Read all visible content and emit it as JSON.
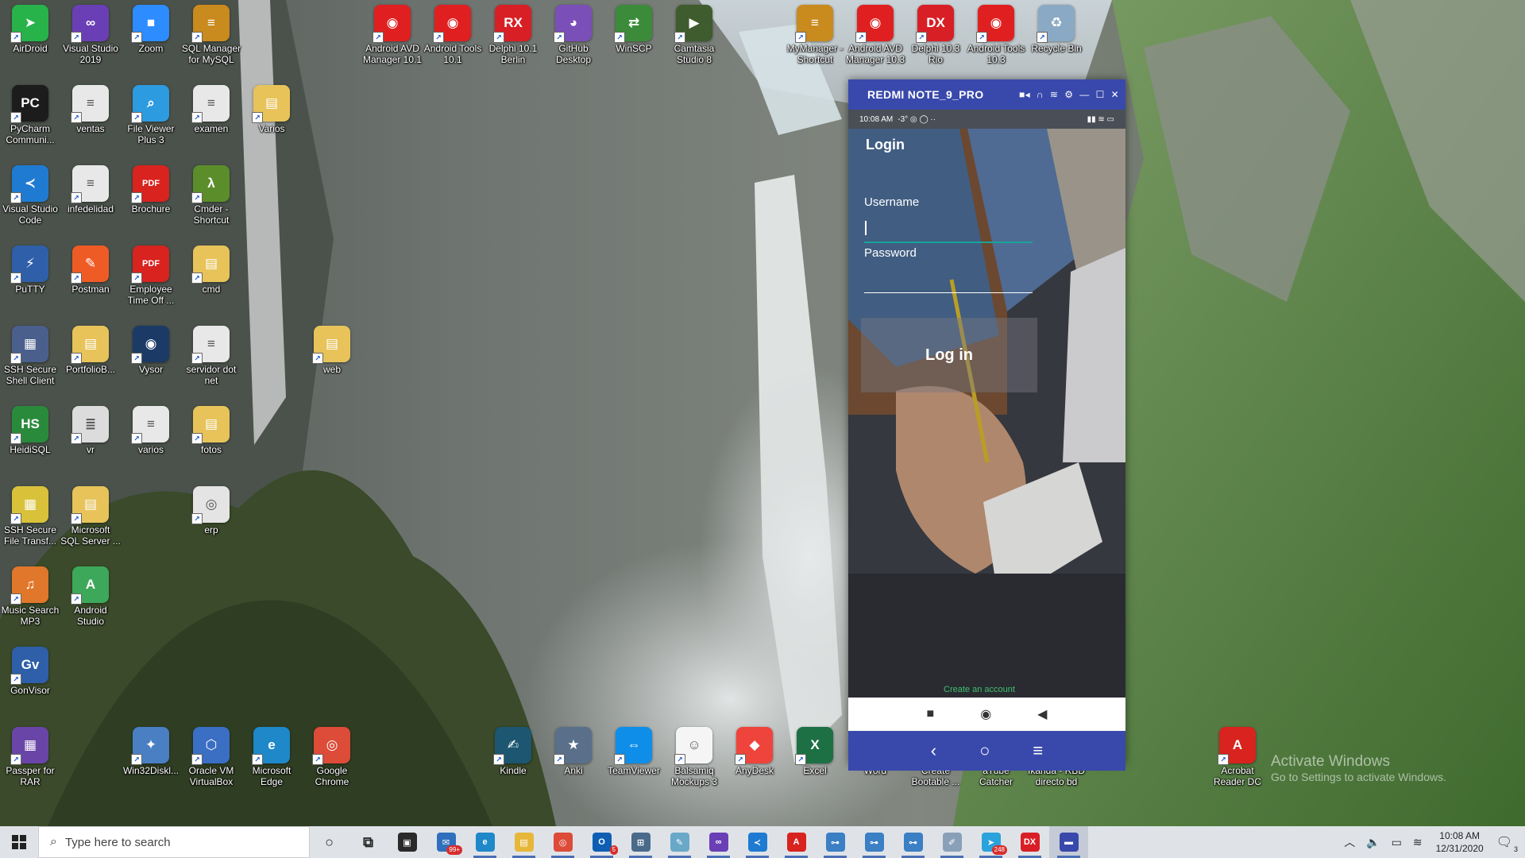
{
  "desktop": {
    "icons": [
      {
        "label": "AirDroid",
        "glyph": "➤",
        "color": "#27b24a",
        "icon": "airdroid-icon"
      },
      {
        "label": "Visual Studio 2019",
        "glyph": "∞",
        "color": "#6a3fb5",
        "icon": "visual-studio-icon"
      },
      {
        "label": "Zoom",
        "glyph": "■",
        "color": "#2d8cff",
        "icon": "zoom-icon"
      },
      {
        "label": "SQL Manager for MySQL",
        "glyph": "≡",
        "color": "#c98a1e",
        "icon": "sql-manager-icon"
      },
      {
        "label": "Android AVD Manager 10.1",
        "glyph": "◉",
        "color": "#e02020",
        "icon": "android-avd-icon"
      },
      {
        "label": "Android Tools 10.1",
        "glyph": "◉",
        "color": "#e02020",
        "icon": "android-tools-icon"
      },
      {
        "label": "Delphi 10.1 Berlin",
        "glyph": "RX",
        "color": "#d81f26",
        "icon": "delphi-icon"
      },
      {
        "label": "GitHub Desktop",
        "glyph": "◕",
        "color": "#7b4fb8",
        "icon": "github-icon"
      },
      {
        "label": "WinSCP",
        "glyph": "⇄",
        "color": "#3b8b3b",
        "icon": "winscp-icon"
      },
      {
        "label": "Camtasia Studio 8",
        "glyph": "▶",
        "color": "#3e5c2e",
        "icon": "camtasia-icon"
      },
      {
        "label": "MyManager - Shortcut",
        "glyph": "≡",
        "color": "#c98a1e",
        "icon": "mymanager-icon"
      },
      {
        "label": "Android AVD Manager 10.3",
        "glyph": "◉",
        "color": "#e02020",
        "icon": "android-avd-icon"
      },
      {
        "label": "Delphi 10.3 Rio",
        "glyph": "DX",
        "color": "#d81f26",
        "icon": "delphi-icon"
      },
      {
        "label": "Android Tools 10.3",
        "glyph": "◉",
        "color": "#e02020",
        "icon": "android-tools-icon"
      },
      {
        "label": "Recycle Bin",
        "glyph": "♻",
        "color": "#8aa9c4",
        "icon": "recycle-bin-icon"
      },
      {
        "label": "PyCharm Communi...",
        "glyph": "PC",
        "color": "#1c1c1c",
        "icon": "pycharm-icon"
      },
      {
        "label": "ventas",
        "glyph": "≡",
        "color": "#e8e8e8",
        "icon": "text-file-icon"
      },
      {
        "label": "File Viewer Plus 3",
        "glyph": "⌕",
        "color": "#2c9be0",
        "icon": "file-viewer-icon"
      },
      {
        "label": "examen",
        "glyph": "≡",
        "color": "#e8e8e8",
        "icon": "text-file-icon"
      },
      {
        "label": "Varios",
        "glyph": "▤",
        "color": "#e7c35a",
        "icon": "folder-icon"
      },
      {
        "label": "Visual Studio Code",
        "glyph": "≺",
        "color": "#1f7bd1",
        "icon": "vscode-icon"
      },
      {
        "label": "infedelidad",
        "glyph": "≡",
        "color": "#e8e8e8",
        "icon": "text-file-icon"
      },
      {
        "label": "Brochure",
        "glyph": "PDF",
        "color": "#d8231f",
        "icon": "pdf-icon"
      },
      {
        "label": "Cmder - Shortcut",
        "glyph": "λ",
        "color": "#5b8e2a",
        "icon": "cmder-icon"
      },
      {
        "label": "PuTTY",
        "glyph": "⚡",
        "color": "#2f5fa8",
        "icon": "putty-icon"
      },
      {
        "label": "Postman",
        "glyph": "✎",
        "color": "#ef5b25",
        "icon": "postman-icon"
      },
      {
        "label": "Employee Time Off ...",
        "glyph": "PDF",
        "color": "#d8231f",
        "icon": "pdf-icon"
      },
      {
        "label": "cmd",
        "glyph": "▤",
        "color": "#e7c35a",
        "icon": "folder-icon"
      },
      {
        "label": "SSH Secure Shell Client",
        "glyph": "▦",
        "color": "#4a5f8c",
        "icon": "ssh-client-icon"
      },
      {
        "label": "PortfolioB...",
        "glyph": "▤",
        "color": "#e7c35a",
        "icon": "folder-icon"
      },
      {
        "label": "Vysor",
        "glyph": "◉",
        "color": "#1b3b66",
        "icon": "vysor-icon"
      },
      {
        "label": "servidor dot net",
        "glyph": "≡",
        "color": "#e8e8e8",
        "icon": "text-file-icon"
      },
      {
        "label": "web",
        "glyph": "▤",
        "color": "#e7c35a",
        "icon": "folder-icon"
      },
      {
        "label": "HeidiSQL",
        "glyph": "HS",
        "color": "#2a8a3c",
        "icon": "heidisql-icon"
      },
      {
        "label": "vr",
        "glyph": "≣",
        "color": "#dcdcdc",
        "icon": "document-icon"
      },
      {
        "label": "varios",
        "glyph": "≡",
        "color": "#e8e8e8",
        "icon": "text-file-icon"
      },
      {
        "label": "fotos",
        "glyph": "▤",
        "color": "#e7c35a",
        "icon": "folder-icon"
      },
      {
        "label": "SSH Secure File Transf...",
        "glyph": "▦",
        "color": "#d9c23a",
        "icon": "ssh-transfer-icon"
      },
      {
        "label": "Microsoft SQL Server ...",
        "glyph": "▤",
        "color": "#e7c35a",
        "icon": "sql-server-icon"
      },
      {
        "label": "erp",
        "glyph": "◎",
        "color": "#e4e4e4",
        "icon": "chrome-shortcut-icon"
      },
      {
        "label": "Music Search MP3",
        "glyph": "♫",
        "color": "#e0772a",
        "icon": "music-search-icon"
      },
      {
        "label": "Android Studio",
        "glyph": "A",
        "color": "#3ea85a",
        "icon": "android-studio-icon"
      },
      {
        "label": "GonVisor",
        "glyph": "Gv",
        "color": "#2e5fa8",
        "icon": "gonvisor-icon"
      },
      {
        "label": "Passper for RAR",
        "glyph": "▦",
        "color": "#6a45a8",
        "icon": "passper-icon"
      },
      {
        "label": "Win32Diskl...",
        "glyph": "✦",
        "color": "#4a7fc4",
        "icon": "win32disk-icon"
      },
      {
        "label": "Oracle VM VirtualBox",
        "glyph": "⬡",
        "color": "#3a6fc4",
        "icon": "virtualbox-icon"
      },
      {
        "label": "Microsoft Edge",
        "glyph": "e",
        "color": "#1e88c8",
        "icon": "edge-icon"
      },
      {
        "label": "Google Chrome",
        "glyph": "◎",
        "color": "#dd4b39",
        "icon": "chrome-icon"
      },
      {
        "label": "Kindle",
        "glyph": "✍",
        "color": "#1c5670",
        "icon": "kindle-icon"
      },
      {
        "label": "Anki",
        "glyph": "★",
        "color": "#5a6f8a",
        "icon": "anki-icon"
      },
      {
        "label": "TeamViewer",
        "glyph": "⇔",
        "color": "#0e8ee9",
        "icon": "teamviewer-icon"
      },
      {
        "label": "Balsamiq Mockups 3",
        "glyph": "☺",
        "color": "#f5f5f5",
        "icon": "balsamiq-icon"
      },
      {
        "label": "AnyDesk",
        "glyph": "◆",
        "color": "#ef443b",
        "icon": "anydesk-icon"
      },
      {
        "label": "Excel",
        "glyph": "X",
        "color": "#1d7044",
        "icon": "excel-icon"
      },
      {
        "label": "Word",
        "glyph": "W",
        "color": "#2b579a",
        "icon": "word-icon"
      },
      {
        "label": "Create Bootable ...",
        "glyph": "▣",
        "color": "#4a6a8a",
        "icon": "bootable-icon"
      },
      {
        "label": "aTube Catcher",
        "glyph": "▶",
        "color": "#c0392b",
        "icon": "atube-icon"
      },
      {
        "label": "Ikanda - RBD directo bd",
        "glyph": "▤",
        "color": "#7a8aa8",
        "icon": "ikanda-icon"
      },
      {
        "label": "Acrobat Reader DC",
        "glyph": "A",
        "color": "#d8231f",
        "icon": "acrobat-icon"
      }
    ]
  },
  "phone_window": {
    "title": "REDMI NOTE_9_PRO",
    "status": {
      "time": "10:08 AM",
      "extra": "-3° ◎ ◯ ··",
      "right": "▮▮ ≋ ▭"
    },
    "app_title": "Login",
    "username_label": "Username",
    "username_value": "",
    "password_label": "Password",
    "login_label": "Log in",
    "create_account": "Create an account"
  },
  "watermark": {
    "line1": "Activate Windows",
    "line2": "Go to Settings to activate Windows."
  },
  "taskbar": {
    "search_placeholder": "Type here to search",
    "apps": [
      {
        "name": "cortana",
        "glyph": "○",
        "color": "transparent",
        "fg": "#222"
      },
      {
        "name": "task-view",
        "glyph": "⧉",
        "color": "transparent",
        "fg": "#222"
      },
      {
        "name": "store",
        "glyph": "▣",
        "color": "#2a2a2a",
        "fg": "#fff"
      },
      {
        "name": "mail",
        "glyph": "✉",
        "color": "#2f6fbd",
        "fg": "#fff",
        "badge": "99+"
      },
      {
        "name": "edge",
        "glyph": "e",
        "color": "#1e88c8",
        "fg": "#fff"
      },
      {
        "name": "file-explorer",
        "glyph": "▤",
        "color": "#e7b73a",
        "fg": "#fff"
      },
      {
        "name": "chrome",
        "glyph": "◎",
        "color": "#dd4b39",
        "fg": "#fff"
      },
      {
        "name": "outlook",
        "glyph": "O",
        "color": "#0e5fb3",
        "fg": "#fff",
        "badge": "5"
      },
      {
        "name": "remote",
        "glyph": "⊞",
        "color": "#4a6a8a",
        "fg": "#fff"
      },
      {
        "name": "notes",
        "glyph": "✎",
        "color": "#6aa8c8",
        "fg": "#fff"
      },
      {
        "name": "visual-studio",
        "glyph": "∞",
        "color": "#6a3fb5",
        "fg": "#fff"
      },
      {
        "name": "vscode",
        "glyph": "≺",
        "color": "#1f7bd1",
        "fg": "#fff"
      },
      {
        "name": "acrobat",
        "glyph": "A",
        "color": "#d8231f",
        "fg": "#fff"
      },
      {
        "name": "ssh1",
        "glyph": "⊶",
        "color": "#3b7fc4",
        "fg": "#fff"
      },
      {
        "name": "ssh2",
        "glyph": "⊶",
        "color": "#3b7fc4",
        "fg": "#fff"
      },
      {
        "name": "ssh3",
        "glyph": "⊶",
        "color": "#3b7fc4",
        "fg": "#fff"
      },
      {
        "name": "paint",
        "glyph": "✐",
        "color": "#8aa0b8",
        "fg": "#fff"
      },
      {
        "name": "telegram",
        "glyph": "➤",
        "color": "#2aa3dc",
        "fg": "#fff",
        "badge": "248"
      },
      {
        "name": "delphi",
        "glyph": "DX",
        "color": "#d81f26",
        "fg": "#fff"
      },
      {
        "name": "vysor",
        "glyph": "▬",
        "color": "#3949ab",
        "fg": "#fff"
      }
    ],
    "clock_time": "10:08 AM",
    "clock_date": "12/31/2020",
    "notification_count": "3"
  }
}
